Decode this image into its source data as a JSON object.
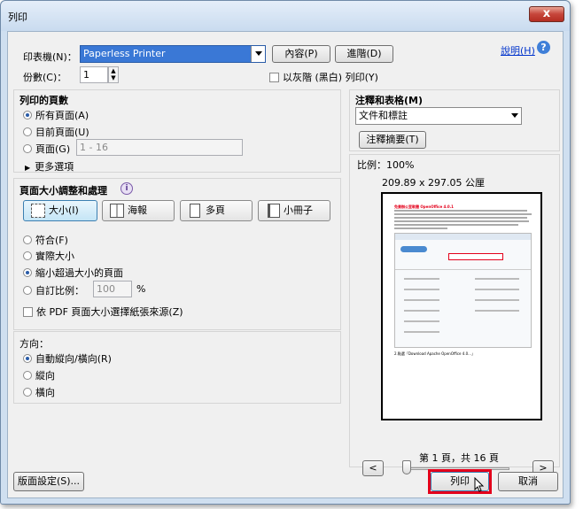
{
  "window": {
    "title": "列印",
    "close_label": "x"
  },
  "printer": {
    "label": "印表機(N)：",
    "value": "Paperless Printer",
    "properties_button": "內容(P)",
    "advanced_button": "進階(D)",
    "help_link": "說明(H)"
  },
  "copies": {
    "label": "份數(C)：",
    "value": "1",
    "grayscale_label": "以灰階 (黑白) 列印(Y)"
  },
  "pages_to_print": {
    "heading": "列印的頁數",
    "all": "所有頁面(A)",
    "current": "目前頁面(U)",
    "pages": "頁面(G)",
    "range_value": "1 - 16",
    "more_options": "更多選項"
  },
  "comments_forms": {
    "heading": "注釋和表格(M)",
    "value": "文件和標註",
    "summarize_button": "注釋摘要(T)"
  },
  "preview": {
    "scale_label": "比例：100%",
    "size_label": "209.89 x 297.05 公厘",
    "page_label": "第 1 頁，共 16 頁",
    "prev": "<",
    "next": ">"
  },
  "sizing": {
    "heading": "頁面大小調整和處理",
    "size_btn": "大小(I)",
    "poster_btn": "海報",
    "multiple_btn": "多頁",
    "booklet_btn": "小冊子",
    "fit": "符合(F)",
    "actual": "實際大小",
    "shrink": "縮小超過大小的頁面",
    "custom": "自訂比例：",
    "custom_value": "100",
    "percent": "%",
    "paper_source": "依 PDF 頁面大小選擇紙張來源(Z)"
  },
  "orientation": {
    "heading": "方向：",
    "auto": "自動縱向/橫向(R)",
    "portrait": "縱向",
    "landscape": "橫向"
  },
  "footer": {
    "page_setup": "版面設定(S)...",
    "print": "列印",
    "cancel": "取消"
  },
  "thumb": {
    "heading": "免費辦公室軟體 OpenOffice 4.0.1",
    "caption": "2.點選「Download Apache OpenOffice 4.0...」"
  },
  "colors": {
    "accent": "#3a78d6",
    "highlight_border": "#e3001b"
  }
}
